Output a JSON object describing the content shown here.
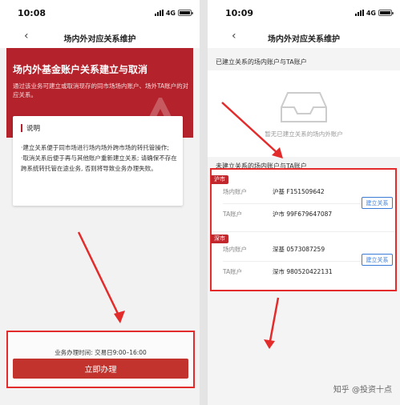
{
  "left": {
    "status_time": "10:08",
    "network": "4G",
    "nav_title": "场内外对应关系维护",
    "banner": {
      "title": "场内外基金账户关系建立与取消",
      "desc": "通过该业务可建立或取消现存的同市场场内账户、场外TA账户的对应关系。"
    },
    "info": {
      "title": "说明",
      "item1": "·建立关系便于同市场进行场内场外跨市场的转托管操作;",
      "item2": "·取消关系后便于再与其他账户重新建立关系; 请确保不存在跨系统转托管在途业务, 否则将导致业务办理失败。"
    },
    "footer": {
      "hours": "业务办理时间: 交易日9:00–16:00",
      "button": "立即办理"
    }
  },
  "right": {
    "status_time": "10:09",
    "network": "4G",
    "nav_title": "场内外对应关系维护",
    "established_label": "已建立关系的场内账户与TA账户",
    "empty_text": "暂无已建立关系的场内外账户",
    "unestablished_label": "未建立关系的场内账户与TA账户",
    "accounts": [
      {
        "tag": "沪市",
        "rows": [
          {
            "key": "场内账户",
            "value": "沪基 F151509642"
          },
          {
            "key": "TA账户",
            "value": "沪市 99F679647087"
          }
        ],
        "button": "建立关系"
      },
      {
        "tag": "深市",
        "rows": [
          {
            "key": "场内账户",
            "value": "深基 0573087259"
          },
          {
            "key": "TA账户",
            "value": "深市 980520422131"
          }
        ],
        "button": "建立关系"
      }
    ]
  },
  "watermark": "知乎 @投资十点",
  "colors": {
    "brand_red": "#b4222c",
    "highlight_red": "#e32b2b",
    "link_blue": "#3a7bd5"
  }
}
